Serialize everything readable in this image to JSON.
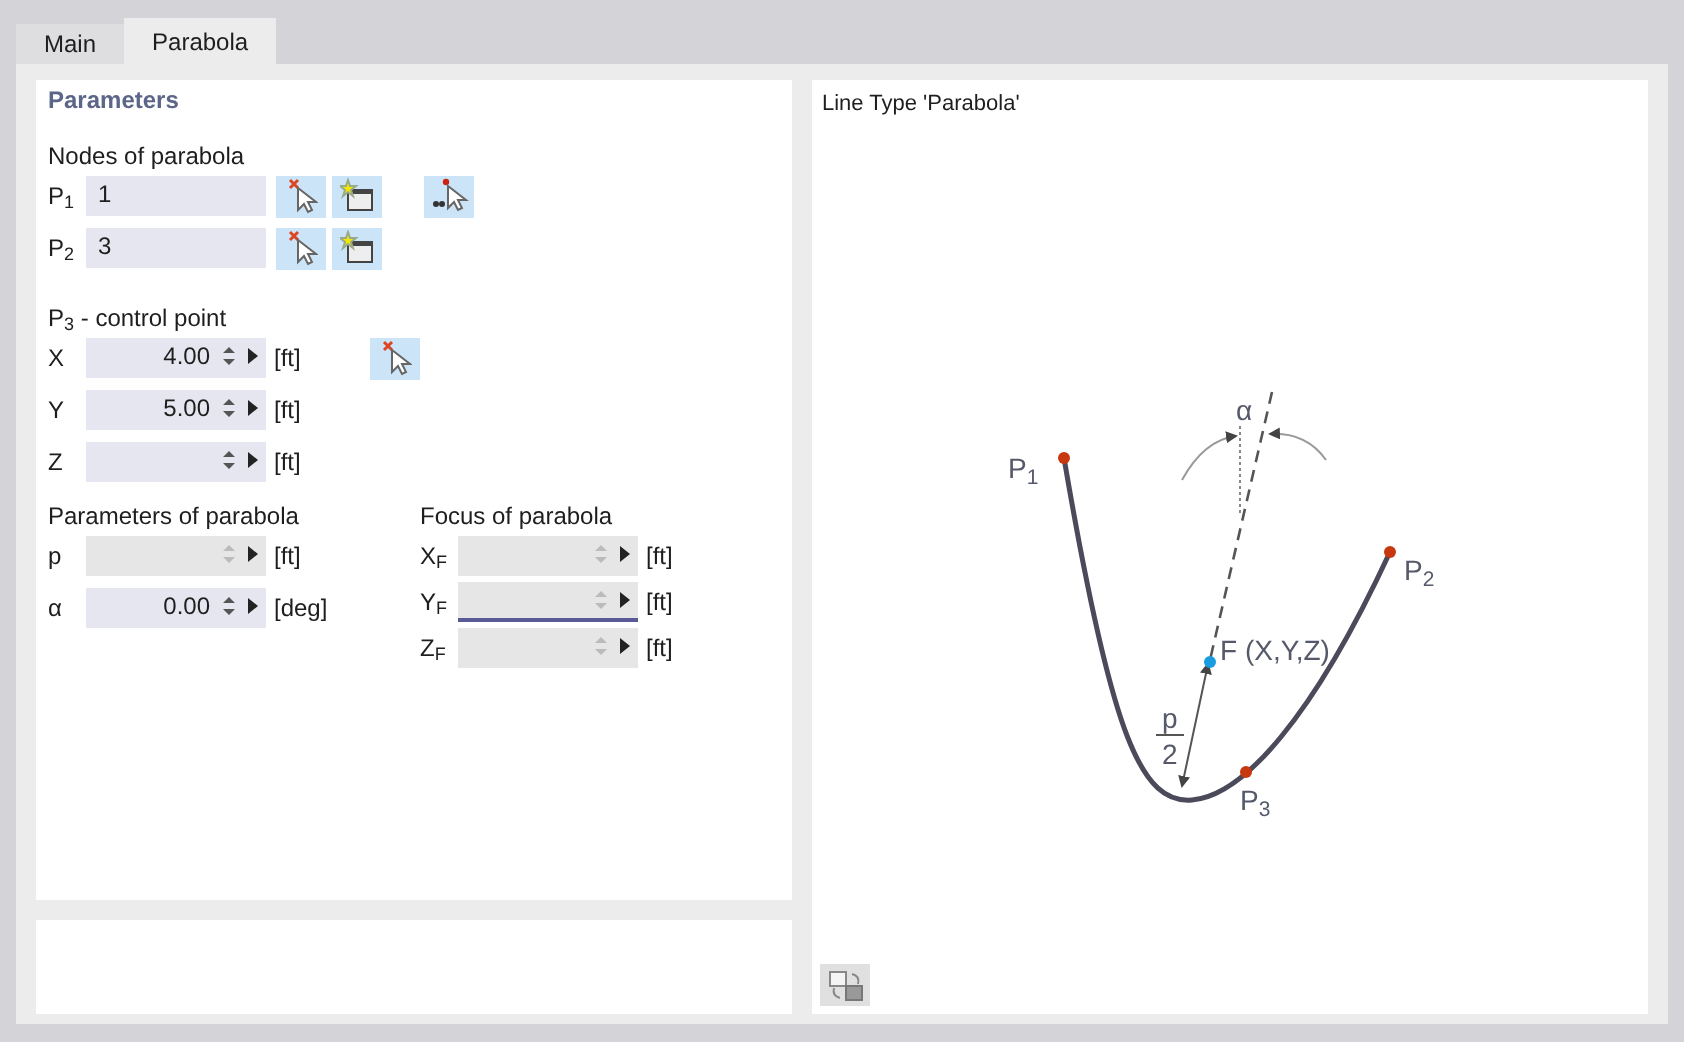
{
  "tabs": [
    {
      "label": "Main",
      "selected": false
    },
    {
      "label": "Parabola",
      "selected": true
    }
  ],
  "parameters": {
    "title": "Parameters",
    "nodes": {
      "title": "Nodes of parabola",
      "rows": [
        {
          "label": "P$_{1}$",
          "value": "1",
          "twice_pick": true
        },
        {
          "label": "P$_{2}$",
          "value": "3",
          "twice_pick": false
        }
      ]
    },
    "control_point": {
      "title": "P$_{3}$ - control point",
      "rows": [
        {
          "label": "X",
          "value": "4.00",
          "unit": "[ft]",
          "disabled": false,
          "focused": false,
          "pick": true
        },
        {
          "label": "Y",
          "value": "5.00",
          "unit": "[ft]",
          "disabled": false,
          "focused": false,
          "pick": false
        },
        {
          "label": "Z",
          "unit": "[ft]",
          "disabled": false,
          "focused": false,
          "pick": false
        }
      ]
    },
    "parabola_parameters": {
      "title": "Parameters of parabola",
      "rows": [
        {
          "label": "p",
          "unit": "[ft]",
          "disabled": true,
          "focused": false
        },
        {
          "label": "α",
          "value": "0.00",
          "unit": "[deg]",
          "disabled": false,
          "focused": false
        }
      ]
    },
    "focus": {
      "title": "Focus of parabola",
      "rows": [
        {
          "label": "X$_{F}$",
          "unit": "[ft]",
          "disabled": true,
          "focused": false
        },
        {
          "label": "Y$_{F}$",
          "unit": "[ft]",
          "disabled": true,
          "focused": true
        },
        {
          "label": "Z$_{F}$",
          "unit": "[ft]",
          "disabled": true,
          "focused": false
        }
      ]
    }
  },
  "diagram": {
    "title": "Line Type 'Parabola'",
    "labels": [
      {
        "kind": "angle",
        "text": "α"
      },
      {
        "kind": "point",
        "text": "P$_{1}$"
      },
      {
        "kind": "point",
        "text": "P$_{2}$"
      },
      {
        "kind": "focus",
        "text": "F (X,Y,Z)"
      },
      {
        "kind": "fraction",
        "numerator": "p",
        "denominator": "2"
      },
      {
        "kind": "point",
        "text": "P$_{3}$"
      }
    ]
  }
}
